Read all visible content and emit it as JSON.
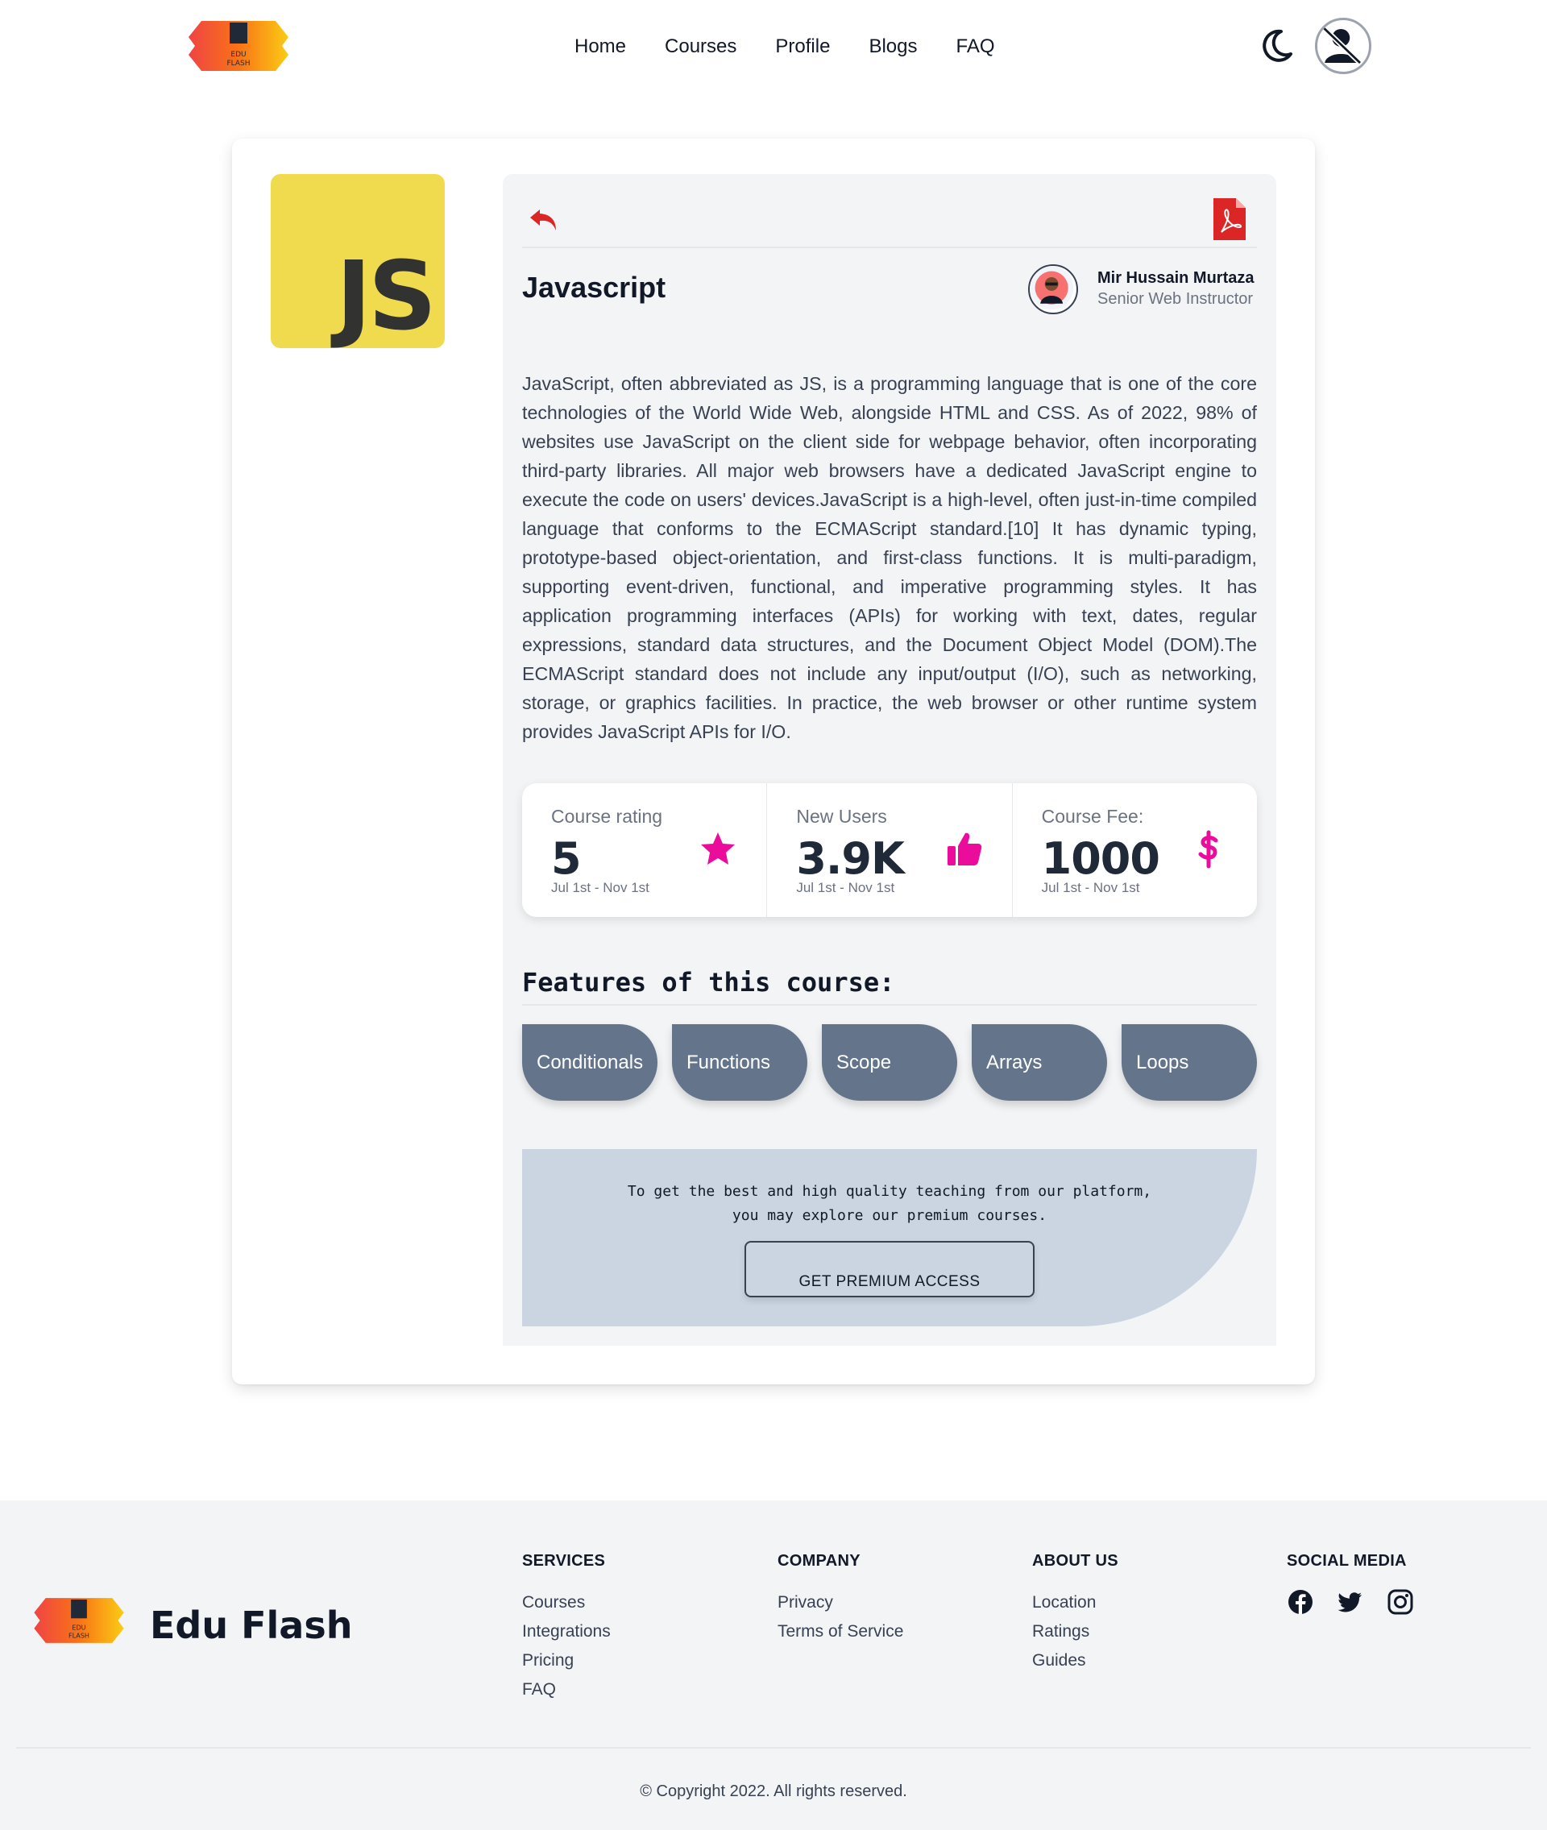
{
  "nav": {
    "logo_text": "EDU FLASH",
    "links": [
      "Home",
      "Courses",
      "Profile",
      "Blogs",
      "FAQ"
    ],
    "theme_icon": "moon-icon",
    "avatar_icon": "user-slash-icon"
  },
  "course": {
    "logo_text": "JS",
    "title": "Javascript",
    "instructor_name": "Mir Hussain Murtaza",
    "instructor_role": "Senior Web Instructor",
    "description": "JavaScript, often abbreviated as JS, is a programming language that is one of the core technologies of the World Wide Web, alongside HTML and CSS. As of 2022, 98% of websites use JavaScript on the client side for webpage behavior, often incorporating third-party libraries. All major web browsers have a dedicated JavaScript engine to execute the code on users' devices.JavaScript is a high-level, often just-in-time compiled language that conforms to the ECMAScript standard.[10] It has dynamic typing, prototype-based object-orientation, and first-class functions. It is multi-paradigm, supporting event-driven, functional, and imperative programming styles. It has application programming interfaces (APIs) for working with text, dates, regular expressions, standard data structures, and the Document Object Model (DOM).The ECMAScript standard does not include any input/output (I/O), such as networking, storage, or graphics facilities. In practice, the web browser or other runtime system provides JavaScript APIs for I/O."
  },
  "stats": [
    {
      "label": "Course rating",
      "value": "5",
      "sub": "Jul 1st - Nov 1st",
      "icon": "star-icon"
    },
    {
      "label": "New Users",
      "value": "3.9K",
      "sub": "Jul 1st - Nov 1st",
      "icon": "thumbs-up-icon"
    },
    {
      "label": "Course Fee:",
      "value": "1000",
      "sub": "Jul 1st - Nov 1st",
      "icon": "dollar-icon"
    }
  ],
  "features": {
    "title": "Features of this course:",
    "items": [
      "Conditionals",
      "Functions",
      "Scope",
      "Arrays",
      "Loops"
    ]
  },
  "premium": {
    "line1": "To get the best and high quality teaching from our platform,",
    "line2": "you may explore our premium courses.",
    "button": "GET PREMIUM ACCESS"
  },
  "footer": {
    "brand": "Edu Flash",
    "columns": [
      {
        "title": "SERVICES",
        "links": [
          "Courses",
          "Integrations",
          "Pricing",
          "FAQ"
        ]
      },
      {
        "title": "COMPANY",
        "links": [
          "Privacy",
          "Terms of Service"
        ]
      },
      {
        "title": "ABOUT US",
        "links": [
          "Location",
          "Ratings",
          "Guides"
        ]
      }
    ],
    "social_title": "SOCIAL MEDIA",
    "social_icons": [
      "facebook-icon",
      "twitter-icon",
      "instagram-icon"
    ],
    "copyright": "© Copyright 2022. All rights reserved."
  },
  "colors": {
    "accent_red": "#dc2626",
    "accent_magenta": "#ec0c9c",
    "pill": "#64748b",
    "premium_bg": "#cbd5e1",
    "js_yellow": "#f0db4f"
  }
}
